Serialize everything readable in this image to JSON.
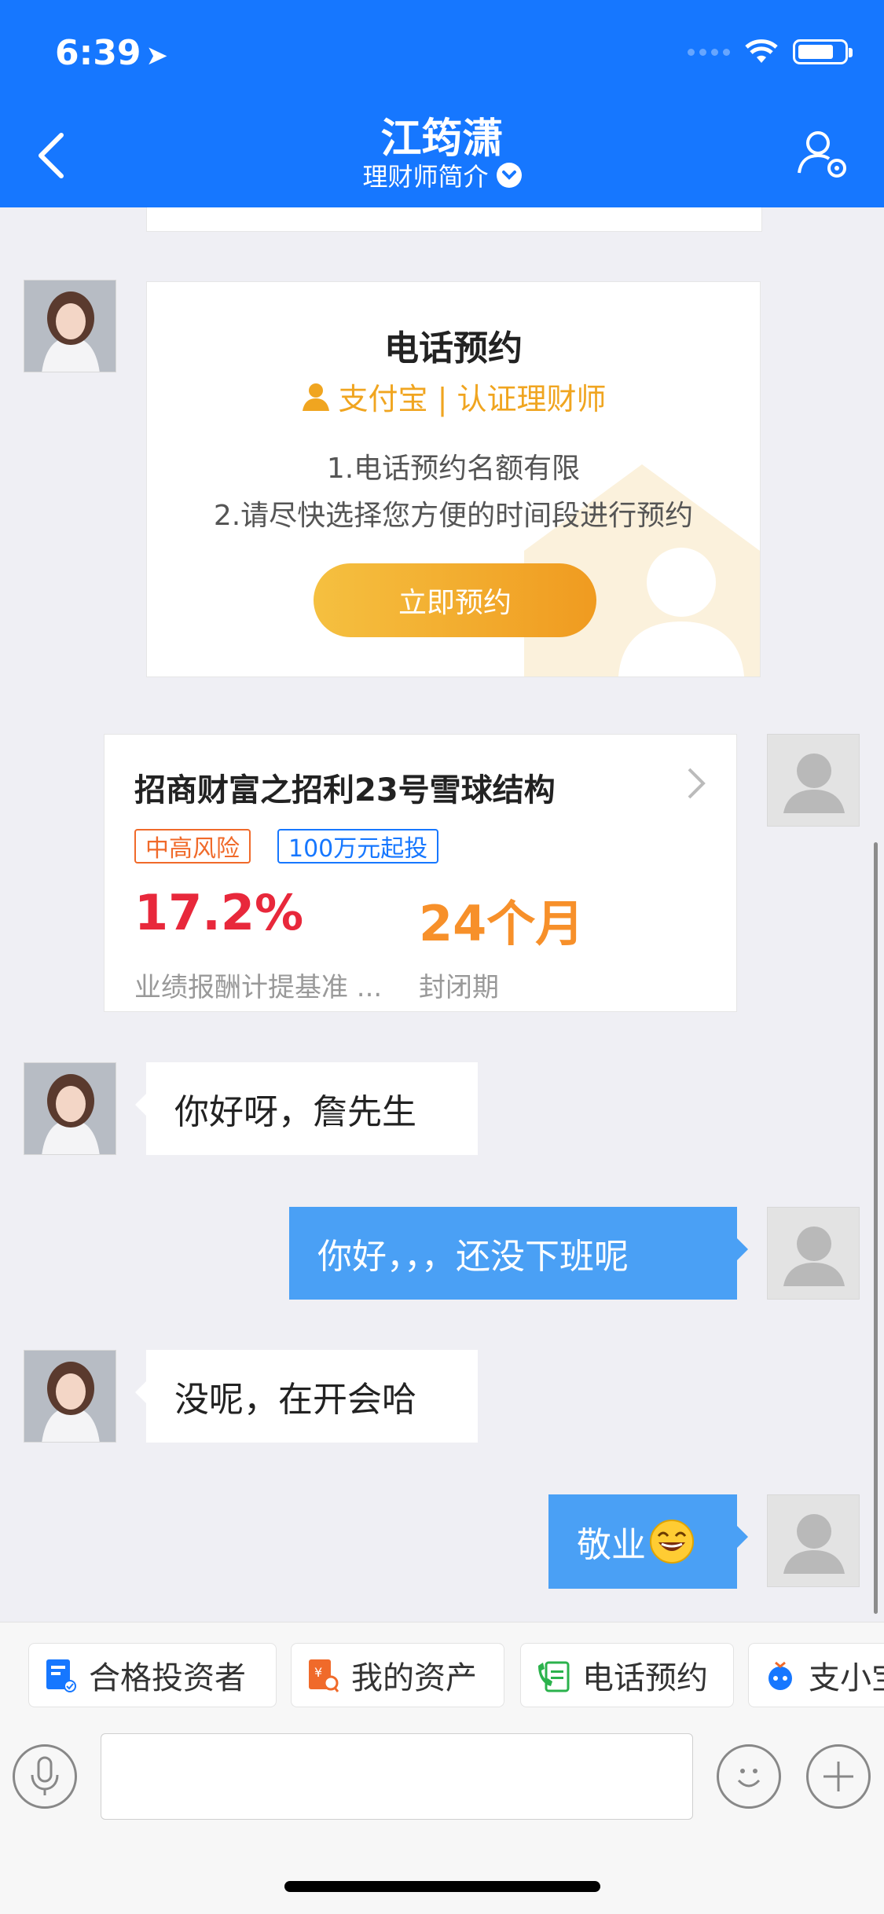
{
  "status_bar": {
    "time": "6:39"
  },
  "header": {
    "title": "江筠潇",
    "subtitle": "理财师简介"
  },
  "appointment_card": {
    "title": "电话预约",
    "brand": "支付宝 | 认证理财师",
    "line1": "1.电话预约名额有限",
    "line2": "2.请尽快选择您方便的时间段进行预约",
    "button": "立即预约"
  },
  "product_card": {
    "name": "招商财富之招利23号雪球结构",
    "risk_tag": "中高风险",
    "min_tag": "100万元起投",
    "rate_value": "17.2%",
    "rate_label": "业绩报酬计提基准 ...",
    "period_value": "24个月",
    "period_label": "封闭期"
  },
  "messages": [
    {
      "from": "advisor",
      "text": "你好呀，詹先生"
    },
    {
      "from": "user",
      "text": "你好，，，还没下班呢"
    },
    {
      "from": "advisor",
      "text": "没呢，在开会哈"
    },
    {
      "from": "user",
      "text": "敬业"
    }
  ],
  "shortcuts": [
    {
      "label": "合格投资者",
      "icon": "qualified-investor-icon",
      "color": "#1677ff"
    },
    {
      "label": "我的资产",
      "icon": "my-assets-icon",
      "color": "#f06a2a"
    },
    {
      "label": "电话预约",
      "icon": "phone-booking-icon",
      "color": "#2bb24c"
    },
    {
      "label": "支小宝",
      "icon": "assistant-icon",
      "color": "#1677ff"
    }
  ],
  "colors": {
    "primary": "#1677ff",
    "accent": "#f0a520",
    "rate_red": "#e8283b",
    "period_orange": "#f7902a"
  }
}
